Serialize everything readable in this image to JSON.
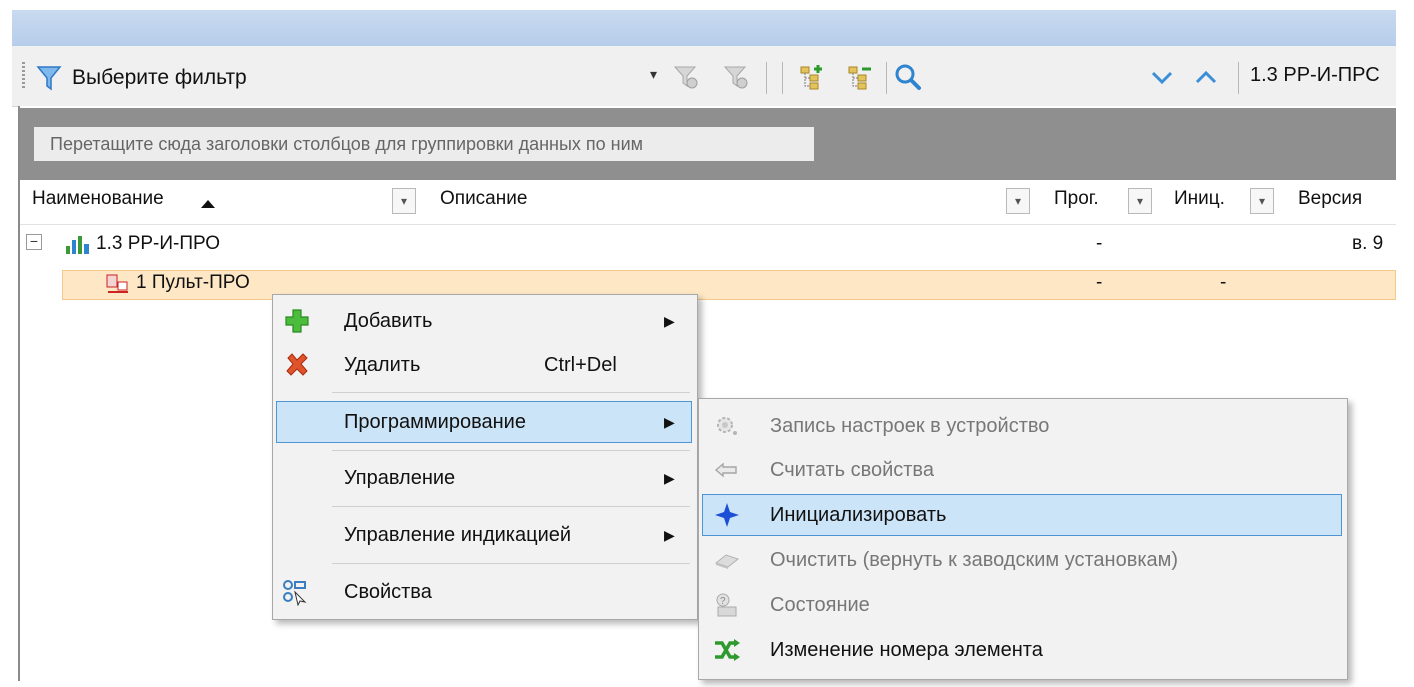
{
  "toolbar": {
    "filter_label": "Выберите фильтр",
    "dropdown_glyph": "▾",
    "breadcrumb": "1.3 РР-И-ПРС"
  },
  "grid": {
    "group_hint": "Перетащите сюда заголовки столбцов для группировки данных по ним",
    "columns": {
      "name": "Наименование",
      "description": "Описание",
      "prog": "Прог.",
      "init": "Иниц.",
      "version": "Версия"
    },
    "rows": [
      {
        "name": "1.3 РР-И-ПРО",
        "prog": "-",
        "init": "",
        "version": "в. 9"
      },
      {
        "name": "1 Пульт-ПРО",
        "prog": "-",
        "init": "-",
        "version": ""
      }
    ]
  },
  "context_menu": {
    "items": [
      {
        "label": "Добавить",
        "shortcut": ""
      },
      {
        "label": "Удалить",
        "shortcut": "Ctrl+Del"
      },
      {
        "label": "Программирование",
        "shortcut": ""
      },
      {
        "label": "Управление",
        "shortcut": ""
      },
      {
        "label": "Управление индикацией",
        "shortcut": ""
      },
      {
        "label": "Свойства",
        "shortcut": ""
      }
    ],
    "submenu_arrow": "▶"
  },
  "submenu": {
    "items": [
      {
        "label": "Запись настроек в устройство"
      },
      {
        "label": "Считать свойства"
      },
      {
        "label": "Инициализировать"
      },
      {
        "label": "Очистить (вернуть к заводским установкам)"
      },
      {
        "label": "Состояние"
      },
      {
        "label": "Изменение номера элемента"
      }
    ]
  },
  "colors": {
    "title_bar": "#c9daf0",
    "selected_row": "#fde7c5",
    "menu_highlight": "#cce4f7",
    "accent_blue": "#3a8fd8"
  }
}
